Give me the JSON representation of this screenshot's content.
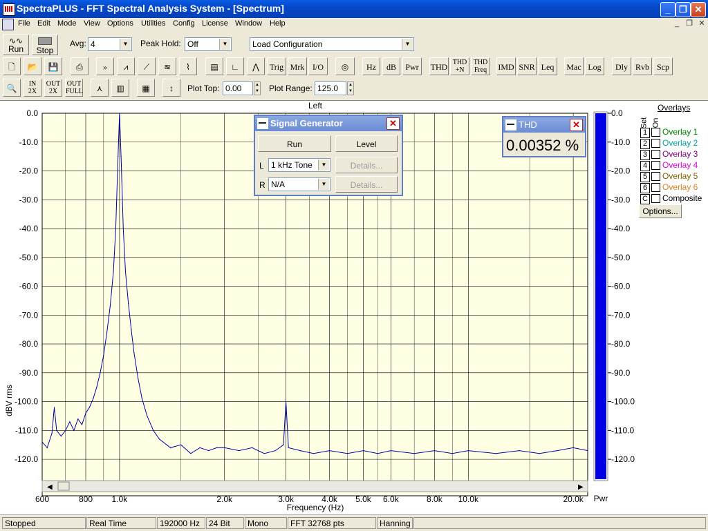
{
  "window": {
    "title": "SpectraPLUS - FFT Spectral Analysis System - [Spectrum]"
  },
  "menu": [
    "File",
    "Edit",
    "Mode",
    "View",
    "Options",
    "Utilities",
    "Config",
    "License",
    "Window",
    "Help"
  ],
  "toolbar1": {
    "run_label": "Run",
    "stop_label": "Stop",
    "avg_label": "Avg:",
    "avg_value": "4",
    "peakhold_label": "Peak Hold:",
    "peakhold_value": "Off",
    "config_value": "Load Configuration"
  },
  "toolbar2": [
    "Trig",
    "Mrk",
    "I/O",
    "Hz",
    "dB",
    "Pwr",
    "THD",
    "THD +N",
    "THD Freq",
    "IMD",
    "SNR",
    "Leq",
    "Mac",
    "Log",
    "Dly",
    "Rvb",
    "Scp"
  ],
  "toolbar3": {
    "zoom_labels": [
      "IN 2X",
      "OUT 2X",
      "OUT FULL"
    ],
    "plot_top_label": "Plot Top:",
    "plot_top_value": "0.00",
    "plot_range_label": "Plot Range:",
    "plot_range_value": "125.0"
  },
  "plot": {
    "channel": "Left",
    "ylabel": "dBV rms",
    "xlabel": "Frequency (Hz)",
    "pwr_label": "Pwr",
    "meter_ticks": [
      "0.0",
      "-10.0",
      "-20.0",
      "-30.0",
      "-40.0",
      "-50.0",
      "-60.0",
      "-70.0",
      "-80.0",
      "-90.0",
      "-100.0",
      "-110.0",
      "-120.0"
    ]
  },
  "chart_data": {
    "type": "line",
    "xscale": "log",
    "xlim": [
      600,
      22000
    ],
    "ylim": [
      -125,
      0
    ],
    "xlabel": "Frequency (Hz)",
    "ylabel": "dBV rms",
    "x_ticks": [
      "600",
      "800",
      "1.0k",
      "2.0k",
      "3.0k",
      "4.0k",
      "5.0k",
      "6.0k",
      "8.0k",
      "10.0k",
      "20.0k"
    ],
    "x_tick_values": [
      600,
      800,
      1000,
      2000,
      3000,
      4000,
      5000,
      6000,
      8000,
      10000,
      20000
    ],
    "y_ticks": [
      "0.0",
      "-10.0",
      "-20.0",
      "-30.0",
      "-40.0",
      "-50.0",
      "-60.0",
      "-70.0",
      "-80.0",
      "-90.0",
      "-100.0",
      "-110.0",
      "-120.0"
    ],
    "y_tick_values": [
      0,
      -10,
      -20,
      -30,
      -40,
      -50,
      -60,
      -70,
      -80,
      -90,
      -100,
      -110,
      -120
    ],
    "grid": true,
    "series": [
      {
        "name": "",
        "points": [
          [
            600,
            -114
          ],
          [
            620,
            -116
          ],
          [
            640,
            -111
          ],
          [
            650,
            -102
          ],
          [
            660,
            -110
          ],
          [
            680,
            -112
          ],
          [
            700,
            -110
          ],
          [
            720,
            -107
          ],
          [
            740,
            -110
          ],
          [
            760,
            -106
          ],
          [
            780,
            -108
          ],
          [
            800,
            -104
          ],
          [
            820,
            -102
          ],
          [
            840,
            -99
          ],
          [
            860,
            -95
          ],
          [
            880,
            -90
          ],
          [
            900,
            -84
          ],
          [
            920,
            -76
          ],
          [
            940,
            -67
          ],
          [
            960,
            -55
          ],
          [
            975,
            -40
          ],
          [
            990,
            -15
          ],
          [
            1000,
            0
          ],
          [
            1010,
            -15
          ],
          [
            1025,
            -40
          ],
          [
            1040,
            -55
          ],
          [
            1060,
            -66
          ],
          [
            1080,
            -75
          ],
          [
            1100,
            -83
          ],
          [
            1130,
            -92
          ],
          [
            1160,
            -99
          ],
          [
            1200,
            -105
          ],
          [
            1250,
            -110
          ],
          [
            1300,
            -113
          ],
          [
            1400,
            -116
          ],
          [
            1500,
            -115
          ],
          [
            1600,
            -118
          ],
          [
            1700,
            -116
          ],
          [
            1800,
            -117
          ],
          [
            1900,
            -116
          ],
          [
            2000,
            -116
          ],
          [
            2200,
            -117
          ],
          [
            2400,
            -116
          ],
          [
            2600,
            -118
          ],
          [
            2800,
            -117
          ],
          [
            2950,
            -115
          ],
          [
            3000,
            -100
          ],
          [
            3050,
            -116
          ],
          [
            3300,
            -117
          ],
          [
            3600,
            -118
          ],
          [
            4000,
            -117
          ],
          [
            4500,
            -118
          ],
          [
            5000,
            -117
          ],
          [
            5500,
            -118
          ],
          [
            6000,
            -117
          ],
          [
            7000,
            -118
          ],
          [
            8000,
            -117
          ],
          [
            9000,
            -118
          ],
          [
            10000,
            -117
          ],
          [
            12000,
            -118
          ],
          [
            14000,
            -117
          ],
          [
            16000,
            -118
          ],
          [
            18000,
            -117
          ],
          [
            20000,
            -116
          ],
          [
            22000,
            -117
          ]
        ]
      }
    ]
  },
  "siggen": {
    "title": "Signal Generator",
    "run_label": "Run",
    "level_label": "Level",
    "left_label": "L",
    "left_value": "1 kHz Tone",
    "right_label": "R",
    "right_value": "N/A",
    "details_label": "Details..."
  },
  "thd": {
    "title": "THD",
    "value": "0.00352 %"
  },
  "overlays": {
    "title": "Overlays",
    "set_label": "Set",
    "on_label": "On",
    "items": [
      {
        "num": "1",
        "name": "Overlay 1",
        "color": "#008000"
      },
      {
        "num": "2",
        "name": "Overlay 2",
        "color": "#00a0a0"
      },
      {
        "num": "3",
        "name": "Overlay 3",
        "color": "#800080"
      },
      {
        "num": "4",
        "name": "Overlay 4",
        "color": "#e000e0"
      },
      {
        "num": "5",
        "name": "Overlay 5",
        "color": "#806000"
      },
      {
        "num": "6",
        "name": "Overlay 6",
        "color": "#e08020"
      },
      {
        "num": "C",
        "name": "Composite",
        "color": "#000000"
      }
    ],
    "options_label": "Options..."
  },
  "status": [
    "Stopped",
    "Real Time",
    "192000 Hz",
    "24 Bit",
    "Mono",
    "FFT 32768 pts",
    "Hanning"
  ]
}
